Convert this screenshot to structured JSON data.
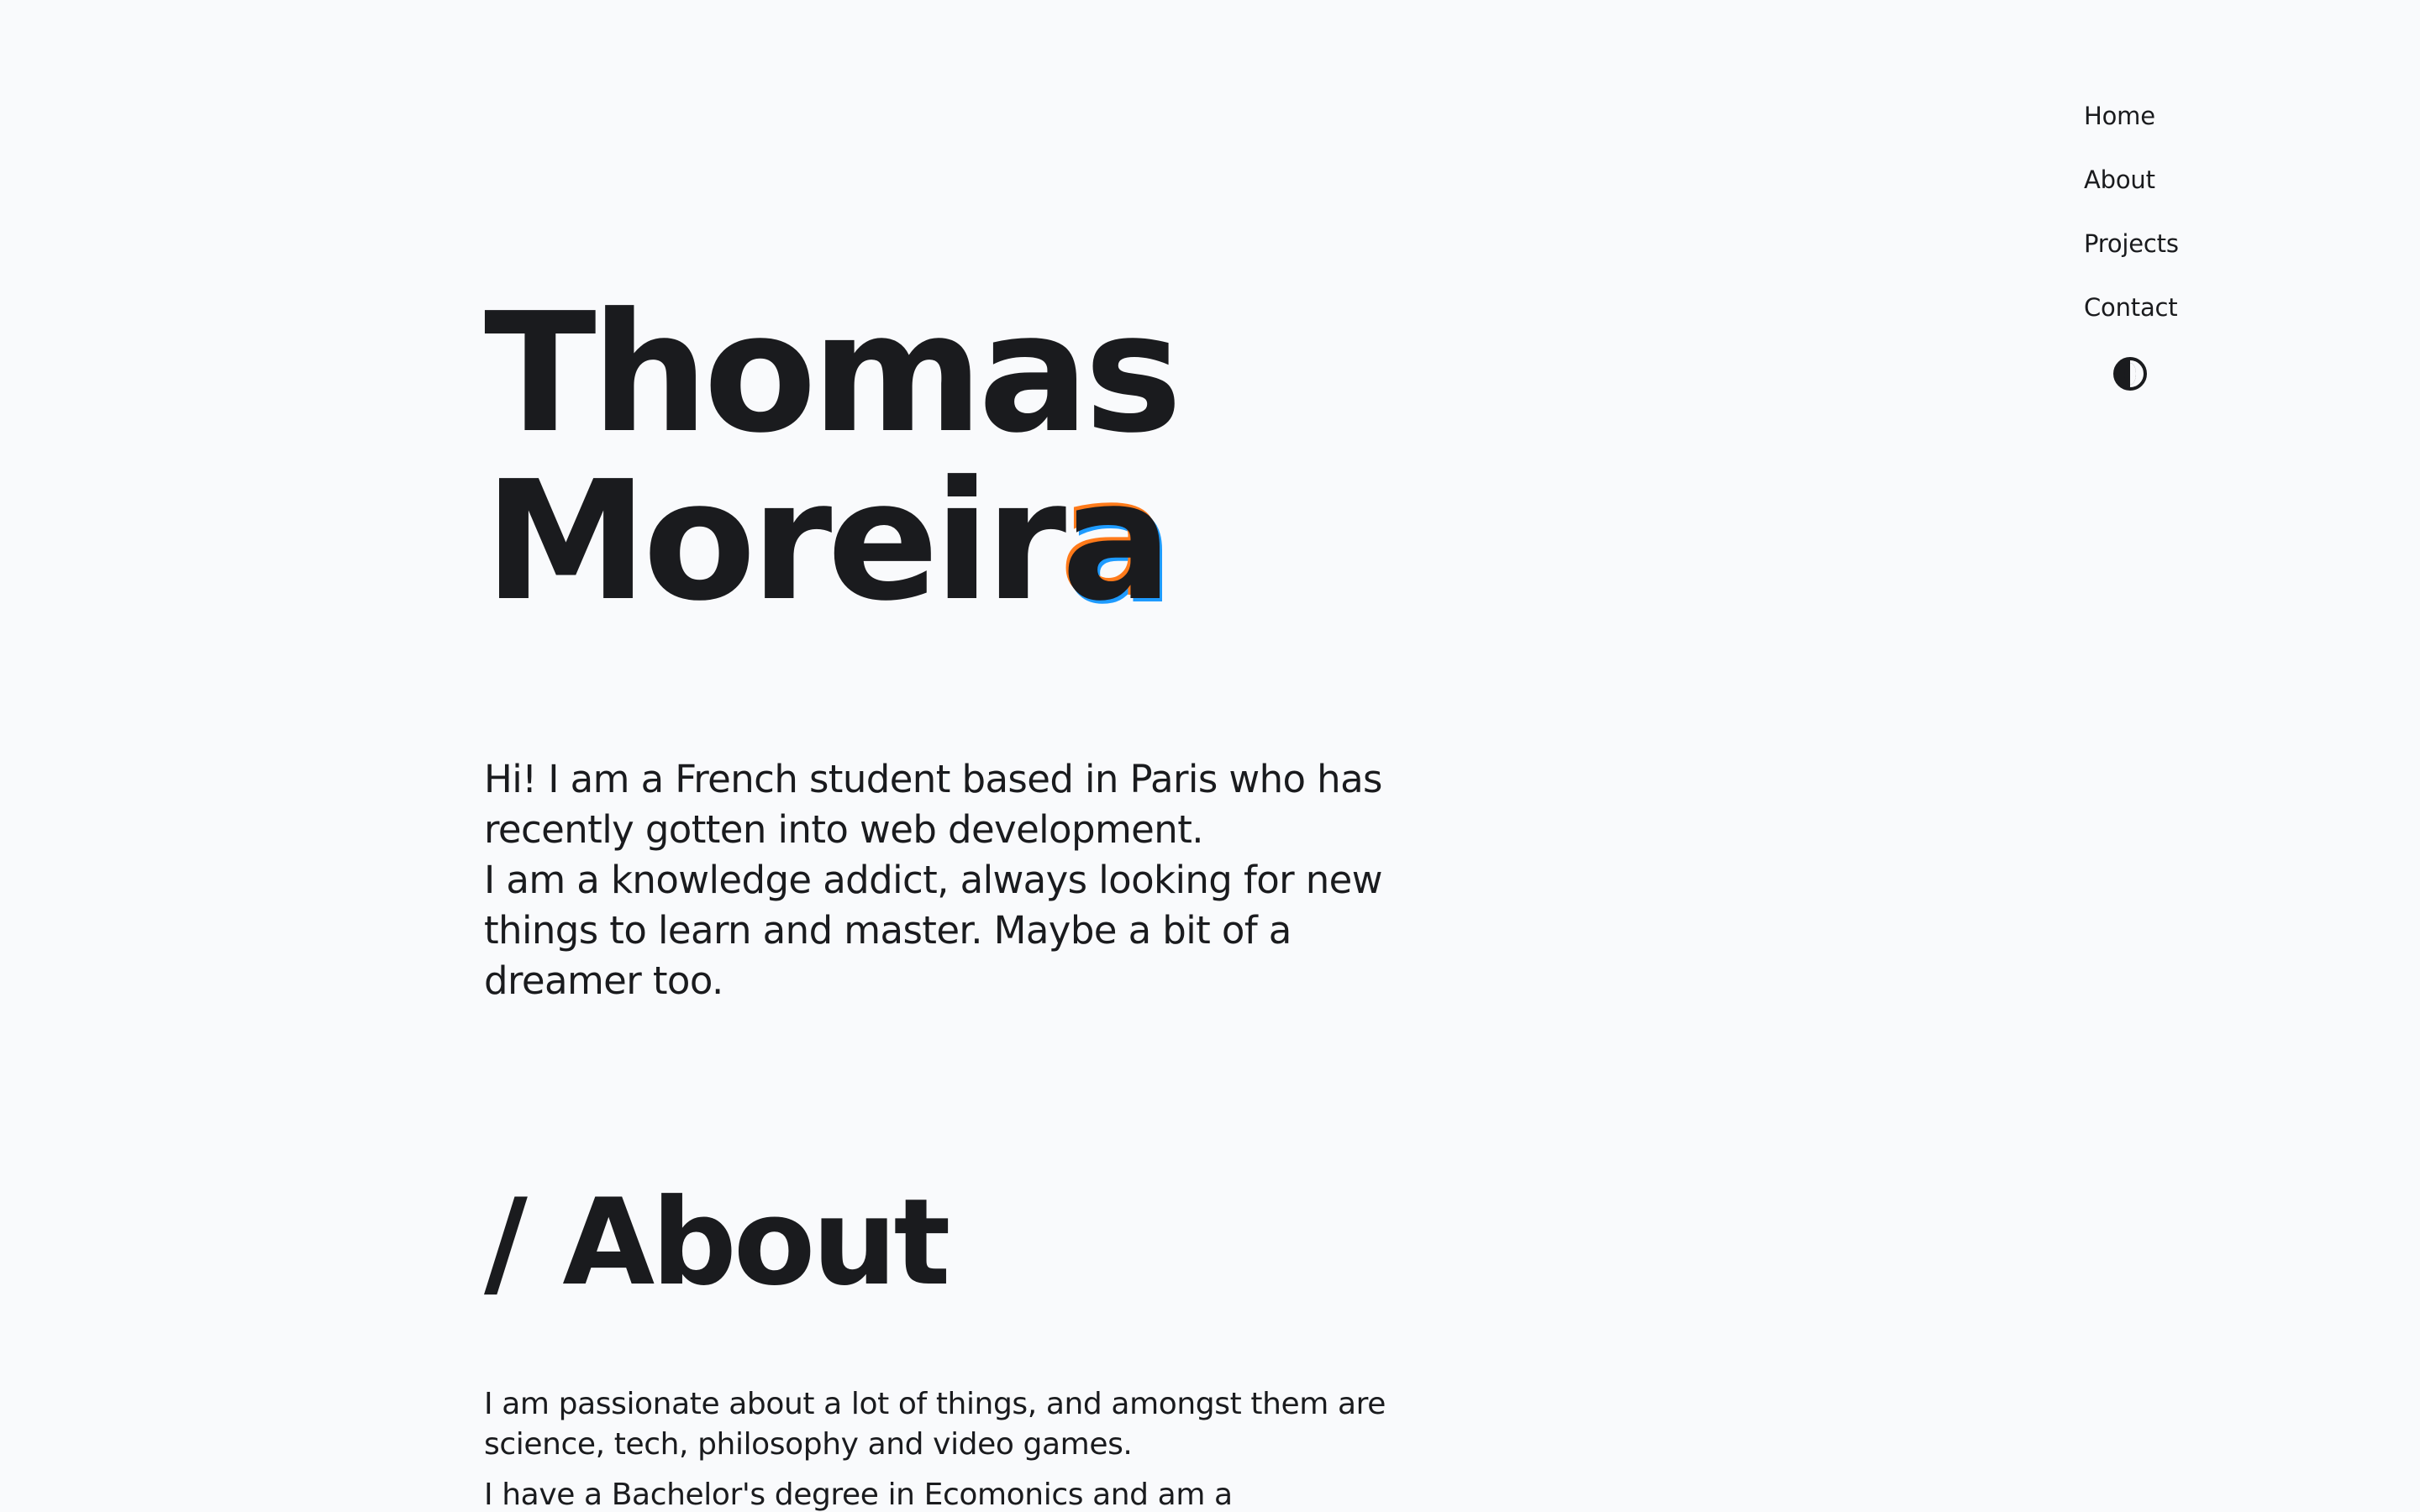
{
  "nav": {
    "items": [
      {
        "label": "Home"
      },
      {
        "label": "About"
      },
      {
        "label": "Projects"
      },
      {
        "label": "Contact"
      }
    ],
    "theme_toggle_icon": "contrast-icon"
  },
  "hero": {
    "name_line1": "Thomas",
    "name_line2_main": "Moreir",
    "name_line2_accent": "a",
    "accent_colors": [
      "#ff7a1a",
      "#1e9bff"
    ],
    "intro_line1": "Hi! I am a French student based in Paris who has recently gotten into web development.",
    "intro_line2": "I am a knowledge addict, always looking for new things to learn and master. Maybe a bit of a dreamer too."
  },
  "about": {
    "title": "/ About",
    "paragraph1": "I am passionate about a lot of things, and amongst them are science, tech, philosophy and video games.",
    "paragraph2": "I have a Bachelor's degree in Ecomonics and am a"
  },
  "colors": {
    "background": "#f9fafc",
    "text": "#1a1b1e"
  }
}
